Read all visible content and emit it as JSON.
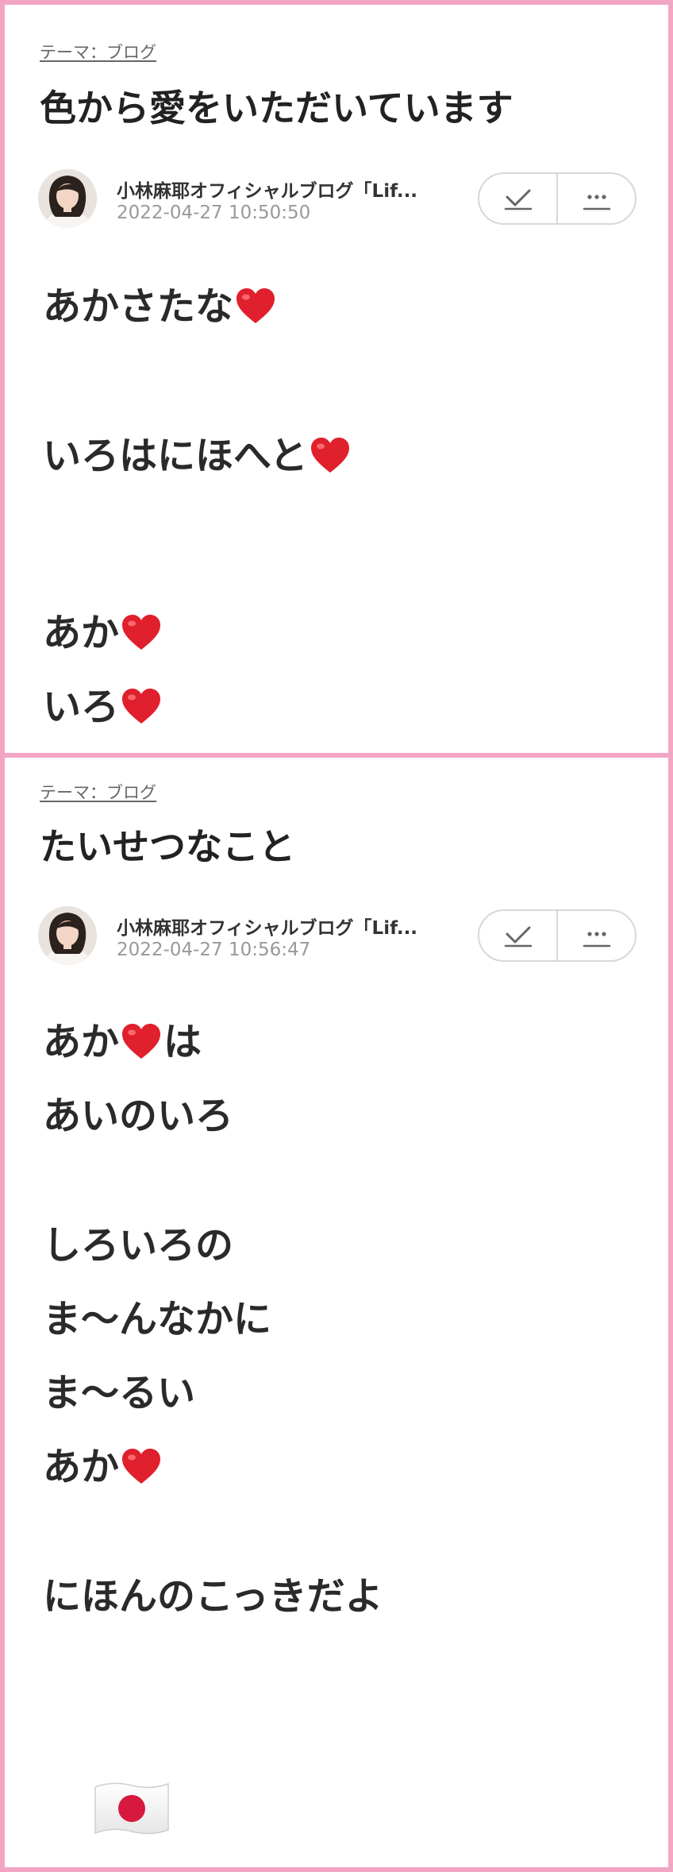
{
  "posts": [
    {
      "theme_label": "テーマ：ブログ",
      "title": "色から愛をいただいています",
      "author": "小林麻耶オフィシャルブログ「Lif...",
      "date": "2022-04-27 10:50:50",
      "lines": [
        {
          "text": "あかさたな",
          "suffix": ""
        },
        {
          "text": "いろはにほへと",
          "suffix": ""
        },
        {
          "text": "あか",
          "suffix": ""
        },
        {
          "text": "いろ",
          "suffix": ""
        }
      ]
    },
    {
      "theme_label": "テーマ：ブログ",
      "title": "たいせつなこと",
      "author": "小林麻耶オフィシャルブログ「Lif...",
      "date": "2022-04-27 10:56:47",
      "lines": [
        {
          "text": "あか",
          "suffix": "は"
        },
        {
          "text": "あいのいろ",
          "suffix": ""
        },
        {
          "text": "しろいろの",
          "suffix": ""
        },
        {
          "text": "ま〜んなかに",
          "suffix": ""
        },
        {
          "text": "ま〜るい",
          "suffix": ""
        },
        {
          "text": "あか",
          "suffix": ""
        },
        {
          "text": "にほんのこっきだよ",
          "suffix": ""
        }
      ]
    }
  ],
  "icons": {
    "heart": "heart-icon",
    "check": "check-icon",
    "more": "more-icon",
    "flag": "japan-flag-icon",
    "avatar": "avatar"
  },
  "colors": {
    "frame": "#f2a6c4",
    "heart": "#e0202c",
    "flag_circle": "#d7193d"
  }
}
